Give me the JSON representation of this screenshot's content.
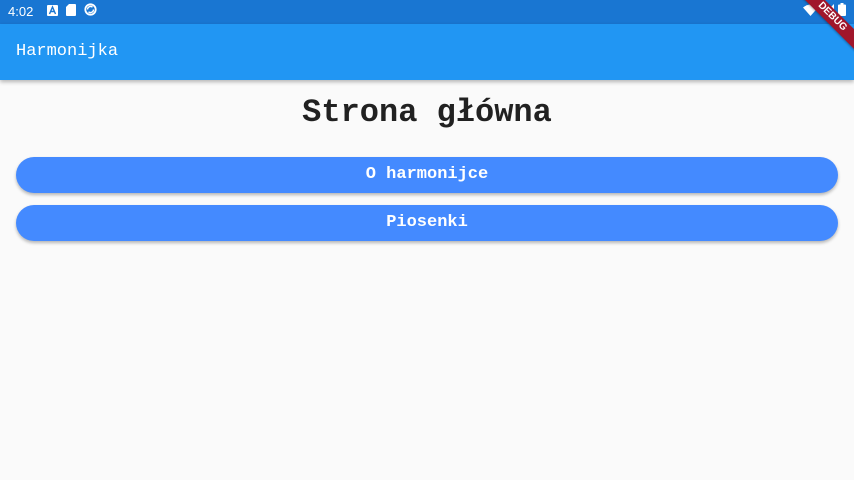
{
  "status_bar": {
    "time": "4:02",
    "left_icons": [
      "text-a-icon",
      "sd-card-icon",
      "sync-icon"
    ],
    "right_icons": [
      "wifi-icon",
      "signal-icon",
      "battery-icon"
    ],
    "color": "#1976d2"
  },
  "app_bar": {
    "title": "Harmonijka",
    "color": "#2196f3"
  },
  "debug_banner": {
    "label": "DEBUG"
  },
  "main": {
    "heading": "Strona główna",
    "buttons": [
      {
        "label": "O harmonijce"
      },
      {
        "label": "Piosenki"
      }
    ],
    "button_color": "#448aff"
  }
}
